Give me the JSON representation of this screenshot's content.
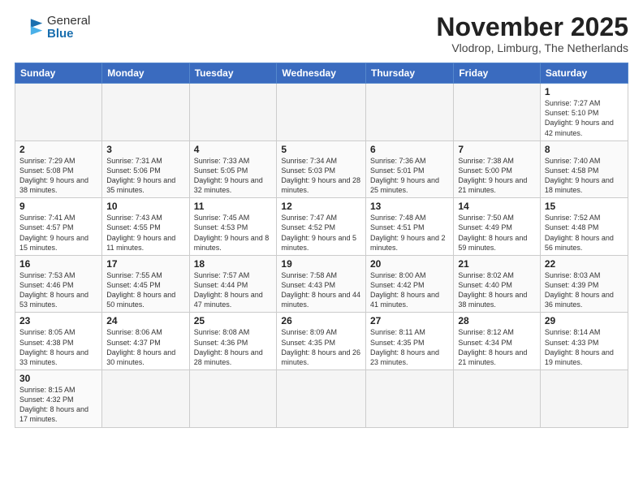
{
  "header": {
    "logo_general": "General",
    "logo_blue": "Blue",
    "month_title": "November 2025",
    "subtitle": "Vlodrop, Limburg, The Netherlands"
  },
  "days_of_week": [
    "Sunday",
    "Monday",
    "Tuesday",
    "Wednesday",
    "Thursday",
    "Friday",
    "Saturday"
  ],
  "weeks": [
    [
      {
        "day": "",
        "info": ""
      },
      {
        "day": "",
        "info": ""
      },
      {
        "day": "",
        "info": ""
      },
      {
        "day": "",
        "info": ""
      },
      {
        "day": "",
        "info": ""
      },
      {
        "day": "",
        "info": ""
      },
      {
        "day": "1",
        "info": "Sunrise: 7:27 AM\nSunset: 5:10 PM\nDaylight: 9 hours and 42 minutes."
      }
    ],
    [
      {
        "day": "2",
        "info": "Sunrise: 7:29 AM\nSunset: 5:08 PM\nDaylight: 9 hours and 38 minutes."
      },
      {
        "day": "3",
        "info": "Sunrise: 7:31 AM\nSunset: 5:06 PM\nDaylight: 9 hours and 35 minutes."
      },
      {
        "day": "4",
        "info": "Sunrise: 7:33 AM\nSunset: 5:05 PM\nDaylight: 9 hours and 32 minutes."
      },
      {
        "day": "5",
        "info": "Sunrise: 7:34 AM\nSunset: 5:03 PM\nDaylight: 9 hours and 28 minutes."
      },
      {
        "day": "6",
        "info": "Sunrise: 7:36 AM\nSunset: 5:01 PM\nDaylight: 9 hours and 25 minutes."
      },
      {
        "day": "7",
        "info": "Sunrise: 7:38 AM\nSunset: 5:00 PM\nDaylight: 9 hours and 21 minutes."
      },
      {
        "day": "8",
        "info": "Sunrise: 7:40 AM\nSunset: 4:58 PM\nDaylight: 9 hours and 18 minutes."
      }
    ],
    [
      {
        "day": "9",
        "info": "Sunrise: 7:41 AM\nSunset: 4:57 PM\nDaylight: 9 hours and 15 minutes."
      },
      {
        "day": "10",
        "info": "Sunrise: 7:43 AM\nSunset: 4:55 PM\nDaylight: 9 hours and 11 minutes."
      },
      {
        "day": "11",
        "info": "Sunrise: 7:45 AM\nSunset: 4:53 PM\nDaylight: 9 hours and 8 minutes."
      },
      {
        "day": "12",
        "info": "Sunrise: 7:47 AM\nSunset: 4:52 PM\nDaylight: 9 hours and 5 minutes."
      },
      {
        "day": "13",
        "info": "Sunrise: 7:48 AM\nSunset: 4:51 PM\nDaylight: 9 hours and 2 minutes."
      },
      {
        "day": "14",
        "info": "Sunrise: 7:50 AM\nSunset: 4:49 PM\nDaylight: 8 hours and 59 minutes."
      },
      {
        "day": "15",
        "info": "Sunrise: 7:52 AM\nSunset: 4:48 PM\nDaylight: 8 hours and 56 minutes."
      }
    ],
    [
      {
        "day": "16",
        "info": "Sunrise: 7:53 AM\nSunset: 4:46 PM\nDaylight: 8 hours and 53 minutes."
      },
      {
        "day": "17",
        "info": "Sunrise: 7:55 AM\nSunset: 4:45 PM\nDaylight: 8 hours and 50 minutes."
      },
      {
        "day": "18",
        "info": "Sunrise: 7:57 AM\nSunset: 4:44 PM\nDaylight: 8 hours and 47 minutes."
      },
      {
        "day": "19",
        "info": "Sunrise: 7:58 AM\nSunset: 4:43 PM\nDaylight: 8 hours and 44 minutes."
      },
      {
        "day": "20",
        "info": "Sunrise: 8:00 AM\nSunset: 4:42 PM\nDaylight: 8 hours and 41 minutes."
      },
      {
        "day": "21",
        "info": "Sunrise: 8:02 AM\nSunset: 4:40 PM\nDaylight: 8 hours and 38 minutes."
      },
      {
        "day": "22",
        "info": "Sunrise: 8:03 AM\nSunset: 4:39 PM\nDaylight: 8 hours and 36 minutes."
      }
    ],
    [
      {
        "day": "23",
        "info": "Sunrise: 8:05 AM\nSunset: 4:38 PM\nDaylight: 8 hours and 33 minutes."
      },
      {
        "day": "24",
        "info": "Sunrise: 8:06 AM\nSunset: 4:37 PM\nDaylight: 8 hours and 30 minutes."
      },
      {
        "day": "25",
        "info": "Sunrise: 8:08 AM\nSunset: 4:36 PM\nDaylight: 8 hours and 28 minutes."
      },
      {
        "day": "26",
        "info": "Sunrise: 8:09 AM\nSunset: 4:35 PM\nDaylight: 8 hours and 26 minutes."
      },
      {
        "day": "27",
        "info": "Sunrise: 8:11 AM\nSunset: 4:35 PM\nDaylight: 8 hours and 23 minutes."
      },
      {
        "day": "28",
        "info": "Sunrise: 8:12 AM\nSunset: 4:34 PM\nDaylight: 8 hours and 21 minutes."
      },
      {
        "day": "29",
        "info": "Sunrise: 8:14 AM\nSunset: 4:33 PM\nDaylight: 8 hours and 19 minutes."
      }
    ],
    [
      {
        "day": "30",
        "info": "Sunrise: 8:15 AM\nSunset: 4:32 PM\nDaylight: 8 hours and 17 minutes."
      },
      {
        "day": "",
        "info": ""
      },
      {
        "day": "",
        "info": ""
      },
      {
        "day": "",
        "info": ""
      },
      {
        "day": "",
        "info": ""
      },
      {
        "day": "",
        "info": ""
      },
      {
        "day": "",
        "info": ""
      }
    ]
  ]
}
